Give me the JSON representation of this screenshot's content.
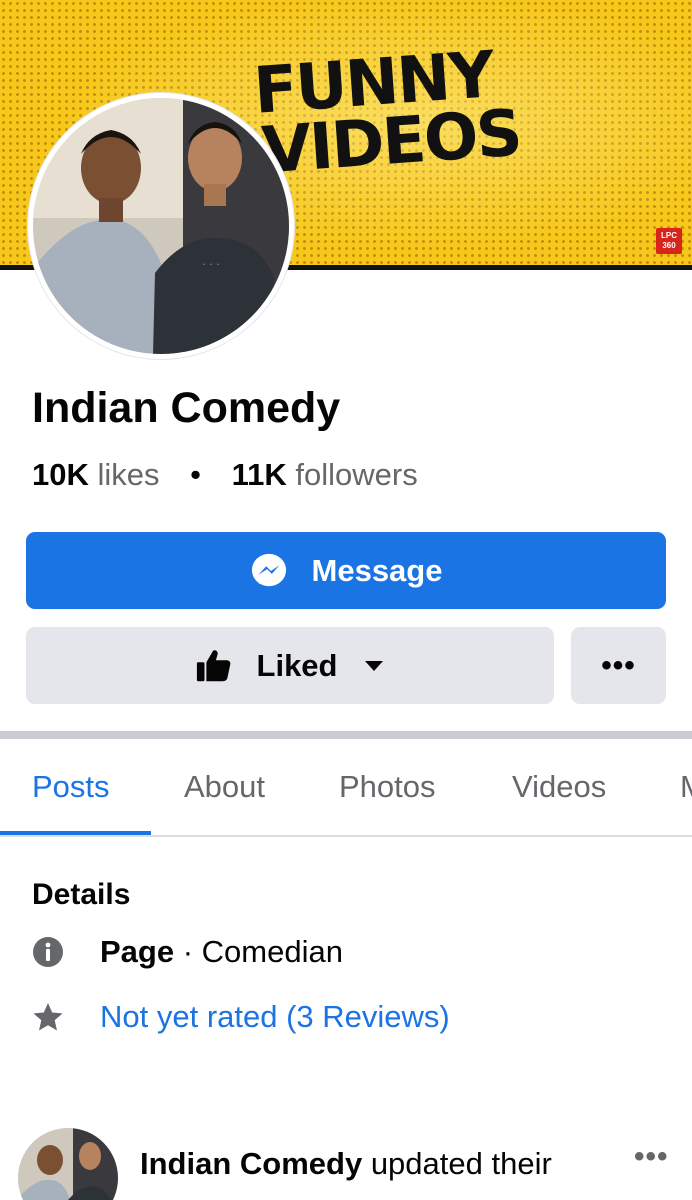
{
  "cover": {
    "title_line1": "FUNNY",
    "title_line2": "VIDEOS",
    "logo_text": "LPC 360",
    "bg_color": "#f7c81a"
  },
  "profile": {
    "name": "Indian Comedy",
    "likes_count": "10K",
    "likes_label": "likes",
    "separator": "•",
    "followers_count": "11K",
    "followers_label": "followers"
  },
  "actions": {
    "message_label": "Message",
    "message_icon": "messenger-icon",
    "liked_label": "Liked",
    "liked_icon": "thumbs-up-icon",
    "more_label": "•••",
    "accent_color": "#1b74e4"
  },
  "tabs": [
    {
      "label": "Posts",
      "active": true
    },
    {
      "label": "About",
      "active": false
    },
    {
      "label": "Photos",
      "active": false
    },
    {
      "label": "Videos",
      "active": false
    },
    {
      "label": "M",
      "active": false
    }
  ],
  "details": {
    "title": "Details",
    "page_label": "Page",
    "page_sep": " · ",
    "page_category": "Comedian",
    "rating_text": "Not yet rated (3 Reviews)",
    "info_icon": "info-icon",
    "star_icon": "star-icon"
  },
  "post": {
    "author": "Indian Comedy",
    "action_text": " updated their",
    "more_label": "•••"
  }
}
